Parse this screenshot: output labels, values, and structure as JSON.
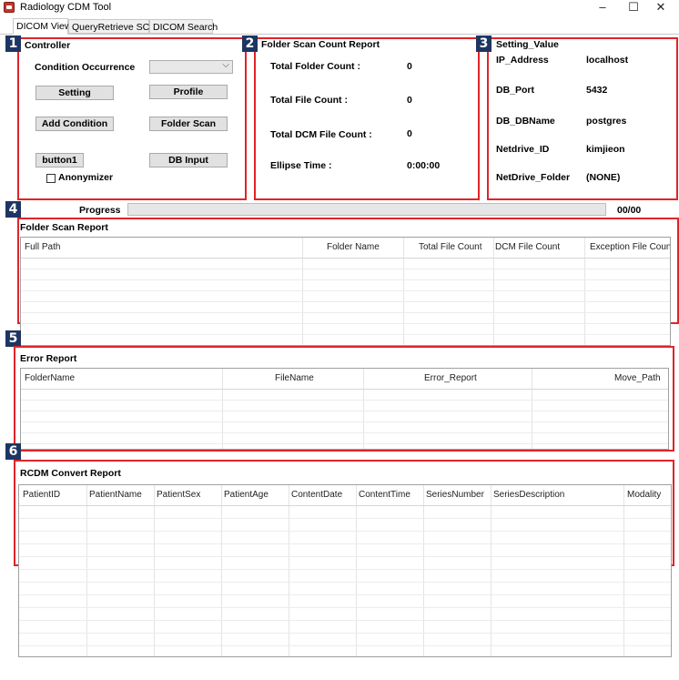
{
  "window": {
    "title": "Radiology CDM Tool",
    "minimize": "–",
    "maximize": "☐",
    "close": "✕"
  },
  "tabs": [
    "DICOM View",
    "QueryRetrieve SCU",
    "DICOM Search"
  ],
  "badges": [
    "1",
    "2",
    "3",
    "4",
    "5",
    "6"
  ],
  "controller": {
    "title": "Controller",
    "condition_label": "Condition Occurrence",
    "condition_value": "",
    "buttons": {
      "setting": "Setting",
      "profile": "Profile",
      "add_condition": "Add Condition",
      "folder_scan": "Folder Scan",
      "button1": "button1",
      "db_input": "DB Input"
    },
    "anonymizer_label": "Anonymizer",
    "anonymizer_checked": false
  },
  "scan_count": {
    "title": "Folder Scan Count Report",
    "rows": [
      {
        "label": "Total Folder Count :",
        "value": "0"
      },
      {
        "label": "Total File Count :",
        "value": "0"
      },
      {
        "label": "Total DCM File Count :",
        "value": "0"
      },
      {
        "label": "Ellipse Time :",
        "value": "0:00:00"
      }
    ]
  },
  "settings": {
    "title": "Setting_Value",
    "rows": [
      {
        "label": "IP_Address",
        "value": "localhost"
      },
      {
        "label": "DB_Port",
        "value": "5432"
      },
      {
        "label": "DB_DBName",
        "value": "postgres"
      },
      {
        "label": "Netdrive_ID",
        "value": "kimjieon"
      },
      {
        "label": "NetDrive_Folder",
        "value": "(NONE)"
      }
    ]
  },
  "progress": {
    "label": "Progress",
    "count": "00/00",
    "fraction": 0
  },
  "folder_scan_report": {
    "title": "Folder Scan Report",
    "columns": [
      "Full Path",
      "Folder Name",
      "Total File Count",
      "DCM File Count",
      "Exception File Coun"
    ]
  },
  "error_report": {
    "title": "Error Report",
    "columns": [
      "FolderName",
      "FileName",
      "Error_Report",
      "Move_Path"
    ]
  },
  "rcdm_report": {
    "title": "RCDM Convert Report",
    "columns": [
      "PatientID",
      "PatientName",
      "PatientSex",
      "PatientAge",
      "ContentDate",
      "ContentTime",
      "SeriesNumber",
      "SeriesDescription",
      "Modality"
    ]
  },
  "colors": {
    "highlight_border": "#e0242a",
    "badge_bg": "#1d3562"
  }
}
